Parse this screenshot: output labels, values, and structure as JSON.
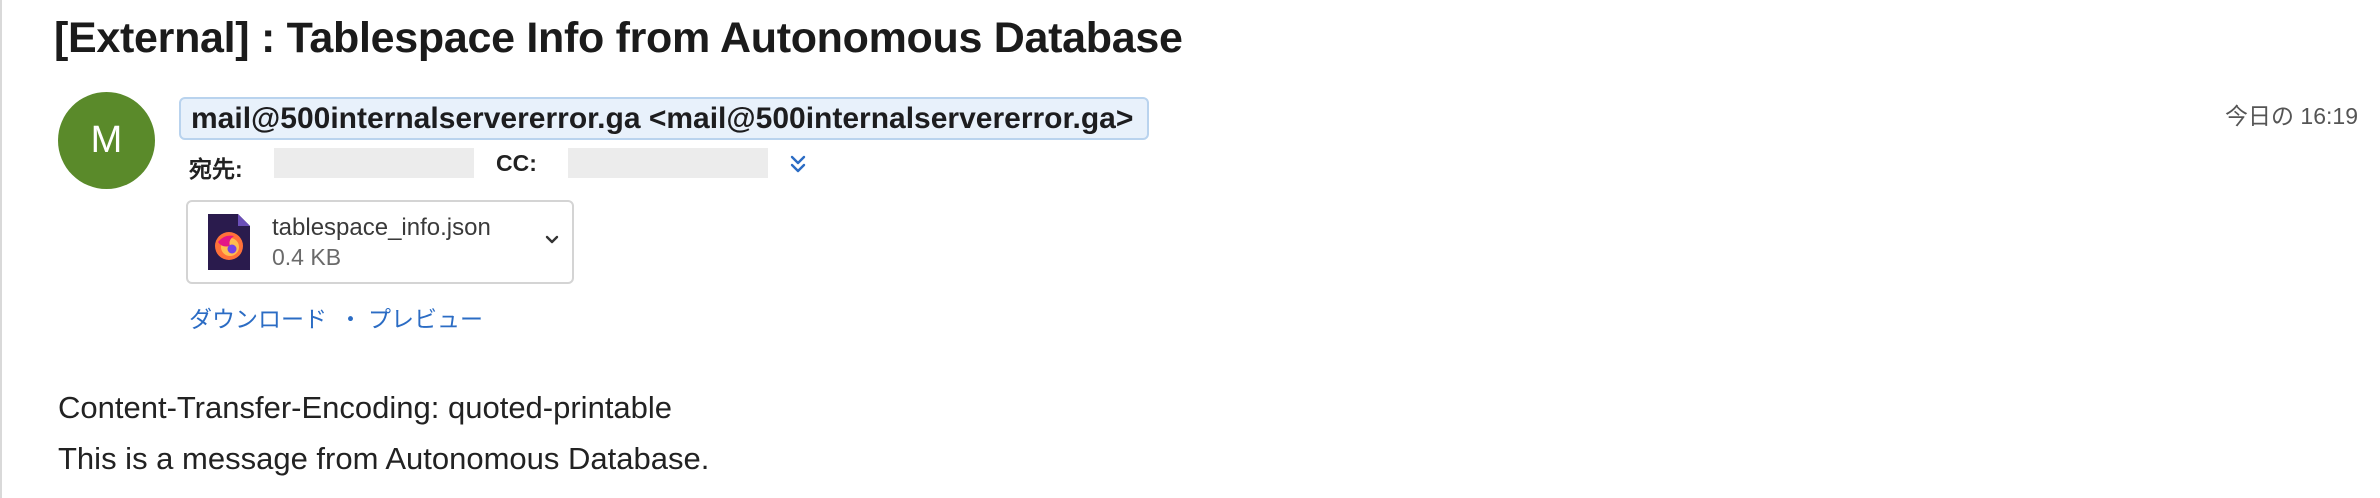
{
  "email": {
    "subject": "[External] : Tablespace Info from Autonomous Database",
    "avatar_initial": "M",
    "sender": "mail@500internalservererror.ga <mail@500internalservererror.ga>",
    "date": "今日の 16:19",
    "to_label": "宛先:",
    "cc_label": "CC:",
    "attachment": {
      "name": "tablespace_info.json",
      "size": "0.4 KB"
    },
    "links": {
      "download": "ダウンロード",
      "separator": "・",
      "preview": "プレビュー"
    },
    "body": [
      "Content-Transfer-Encoding: quoted-printable",
      "This is a message from Autonomous Database."
    ]
  },
  "colors": {
    "avatar": "#5a8a2a",
    "link": "#2b6cc4",
    "sender_bg": "#e8f1fb"
  },
  "icons": {
    "attachment": "firefox-file-icon",
    "attachment_menu": "chevron-down-icon",
    "expand_recipients": "double-chevron-down-icon"
  }
}
